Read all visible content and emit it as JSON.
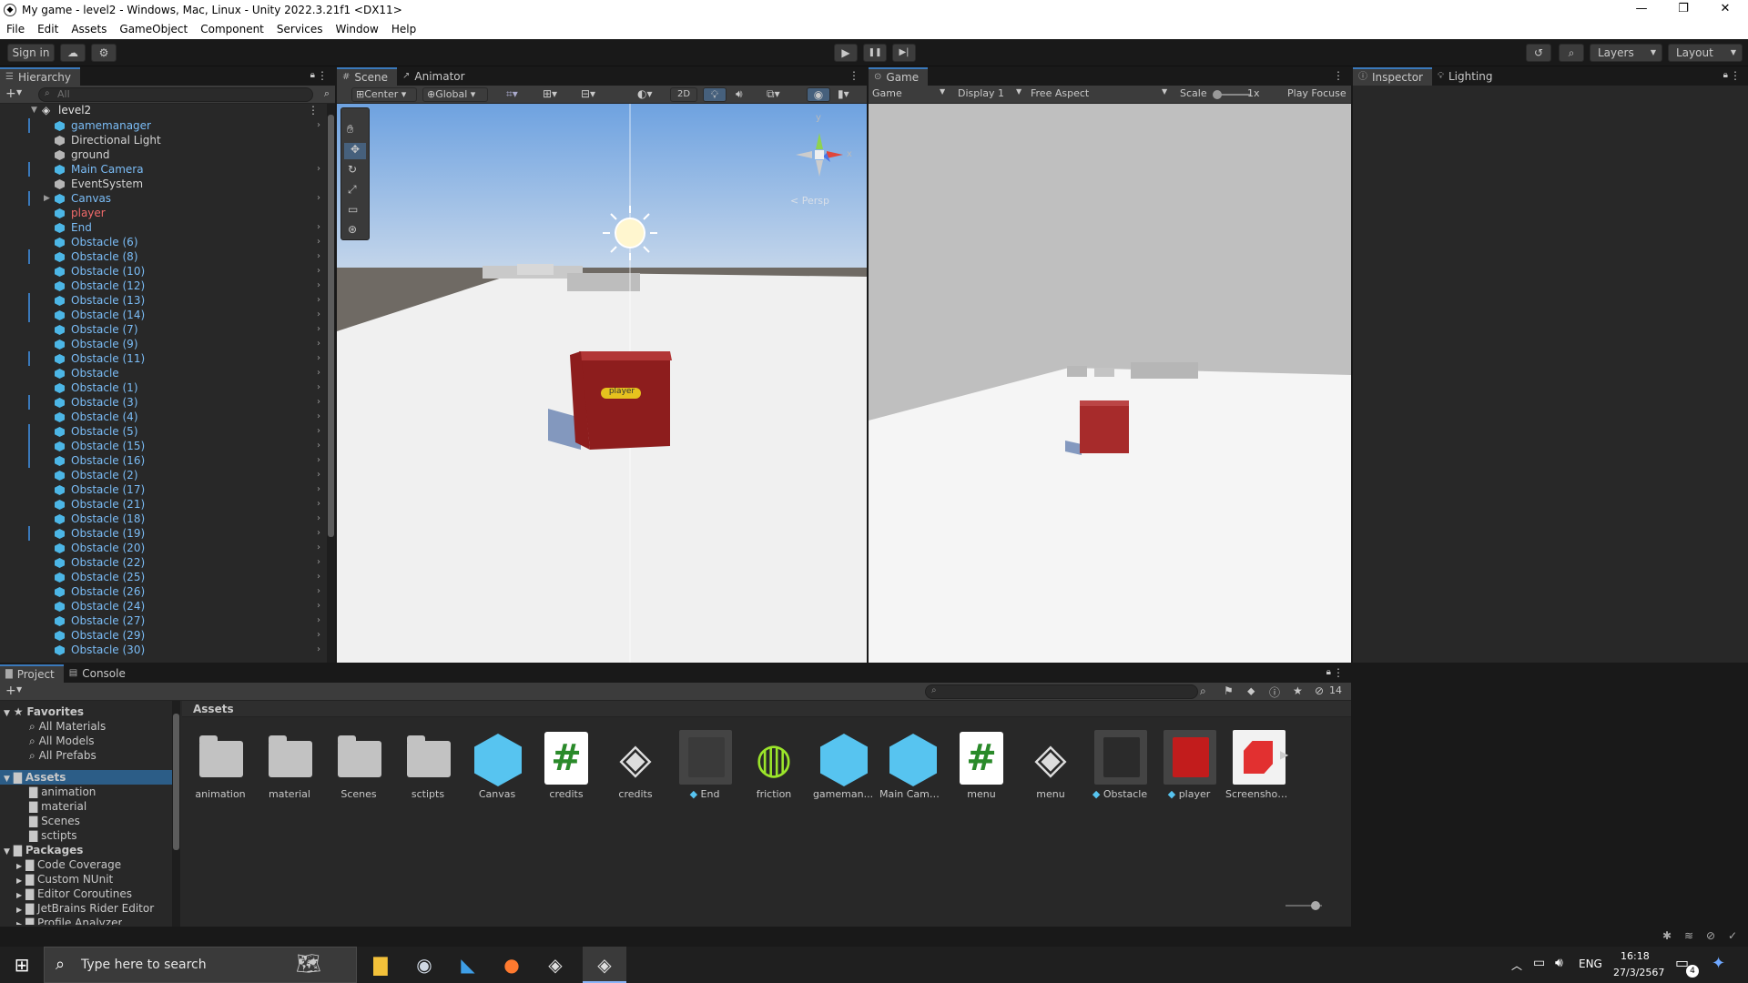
{
  "window": {
    "title": "My game - level2 - Windows, Mac, Linux - Unity 2022.3.21f1 <DX11>",
    "min": "—",
    "max": "❐",
    "close": "✕"
  },
  "menu": [
    "File",
    "Edit",
    "Assets",
    "GameObject",
    "Component",
    "Services",
    "Window",
    "Help"
  ],
  "toolbar": {
    "sign_in": "Sign in",
    "layers": "Layers",
    "layout": "Layout",
    "play": "▶",
    "pause": "❚❚",
    "step": "▶|"
  },
  "hierarchy": {
    "tab": "Hierarchy",
    "search_placeholder": "All",
    "scene": "level2",
    "items": [
      {
        "name": "gamemanager",
        "style": "blue",
        "chev": true,
        "mark": true
      },
      {
        "name": "Directional Light",
        "style": "white",
        "chev": false,
        "mark": false,
        "icon": "gray"
      },
      {
        "name": "ground",
        "style": "white",
        "chev": false,
        "mark": false,
        "icon": "gray"
      },
      {
        "name": "Main Camera",
        "style": "blue",
        "chev": true,
        "mark": true
      },
      {
        "name": "EventSystem",
        "style": "white",
        "chev": false,
        "mark": false,
        "icon": "gray"
      },
      {
        "name": "Canvas",
        "style": "blue",
        "chev": true,
        "mark": true,
        "tri": true
      },
      {
        "name": "player",
        "style": "red",
        "chev": false,
        "mark": false
      },
      {
        "name": "End",
        "style": "blue",
        "chev": true,
        "mark": false
      },
      {
        "name": "Obstacle (6)",
        "style": "blue",
        "chev": true,
        "mark": false
      },
      {
        "name": "Obstacle (8)",
        "style": "blue",
        "chev": true,
        "mark": true
      },
      {
        "name": "Obstacle (10)",
        "style": "blue",
        "chev": true,
        "mark": false
      },
      {
        "name": "Obstacle (12)",
        "style": "blue",
        "chev": true,
        "mark": false
      },
      {
        "name": "Obstacle (13)",
        "style": "blue",
        "chev": true,
        "mark": true
      },
      {
        "name": "Obstacle (14)",
        "style": "blue",
        "chev": true,
        "mark": true
      },
      {
        "name": "Obstacle (7)",
        "style": "blue",
        "chev": true,
        "mark": false
      },
      {
        "name": "Obstacle (9)",
        "style": "blue",
        "chev": true,
        "mark": false
      },
      {
        "name": "Obstacle (11)",
        "style": "blue",
        "chev": true,
        "mark": true
      },
      {
        "name": "Obstacle",
        "style": "blue",
        "chev": true,
        "mark": false
      },
      {
        "name": "Obstacle (1)",
        "style": "blue",
        "chev": true,
        "mark": false
      },
      {
        "name": "Obstacle (3)",
        "style": "blue",
        "chev": true,
        "mark": true
      },
      {
        "name": "Obstacle (4)",
        "style": "blue",
        "chev": true,
        "mark": false
      },
      {
        "name": "Obstacle (5)",
        "style": "blue",
        "chev": true,
        "mark": true
      },
      {
        "name": "Obstacle (15)",
        "style": "blue",
        "chev": true,
        "mark": true
      },
      {
        "name": "Obstacle (16)",
        "style": "blue",
        "chev": true,
        "mark": true
      },
      {
        "name": "Obstacle (2)",
        "style": "blue",
        "chev": true,
        "mark": false
      },
      {
        "name": "Obstacle (17)",
        "style": "blue",
        "chev": true,
        "mark": false
      },
      {
        "name": "Obstacle (21)",
        "style": "blue",
        "chev": true,
        "mark": false
      },
      {
        "name": "Obstacle (18)",
        "style": "blue",
        "chev": true,
        "mark": false
      },
      {
        "name": "Obstacle (19)",
        "style": "blue",
        "chev": true,
        "mark": true
      },
      {
        "name": "Obstacle (20)",
        "style": "blue",
        "chev": true,
        "mark": false
      },
      {
        "name": "Obstacle (22)",
        "style": "blue",
        "chev": true,
        "mark": false
      },
      {
        "name": "Obstacle (25)",
        "style": "blue",
        "chev": true,
        "mark": false
      },
      {
        "name": "Obstacle (26)",
        "style": "blue",
        "chev": true,
        "mark": false
      },
      {
        "name": "Obstacle (24)",
        "style": "blue",
        "chev": true,
        "mark": false
      },
      {
        "name": "Obstacle (27)",
        "style": "blue",
        "chev": true,
        "mark": false
      },
      {
        "name": "Obstacle (29)",
        "style": "blue",
        "chev": true,
        "mark": false
      },
      {
        "name": "Obstacle (30)",
        "style": "blue",
        "chev": true,
        "mark": false
      }
    ]
  },
  "scene": {
    "tab": "Scene",
    "tab2": "Animator",
    "center": "Center",
    "global": "Global",
    "btn_2d": "2D",
    "persp": "< Persp",
    "player_label": "player",
    "axis_y": "y",
    "axis_x": "x"
  },
  "game": {
    "tab": "Game",
    "mode": "Game",
    "display": "Display 1",
    "aspect": "Free Aspect",
    "scale_label": "Scale",
    "scale_val": "1x",
    "play_focus": "Play Focuse"
  },
  "inspector": {
    "tab": "Inspector",
    "tab2": "Lighting"
  },
  "project": {
    "tab": "Project",
    "tab2": "Console",
    "breadcrumb": "Assets",
    "hidden_count": "14",
    "favorites": {
      "label": "Favorites",
      "items": [
        "All Materials",
        "All Models",
        "All Prefabs"
      ]
    },
    "assets_root": {
      "label": "Assets",
      "items": [
        "animation",
        "material",
        "Scenes",
        "sctipts"
      ]
    },
    "packages": {
      "label": "Packages",
      "items": [
        "Code Coverage",
        "Custom NUnit",
        "Editor Coroutines",
        "JetBrains Rider Editor",
        "Profile Analyzer"
      ]
    },
    "grid": [
      {
        "label": "animation",
        "kind": "folder"
      },
      {
        "label": "material",
        "kind": "folder"
      },
      {
        "label": "Scenes",
        "kind": "folder"
      },
      {
        "label": "sctipts",
        "kind": "folder"
      },
      {
        "label": "Canvas",
        "kind": "cube"
      },
      {
        "label": "credits",
        "kind": "script"
      },
      {
        "label": "credits",
        "kind": "unity"
      },
      {
        "label": "End",
        "kind": "thumb",
        "color": "#3a3a3a",
        "prefab": true
      },
      {
        "label": "friction",
        "kind": "physic"
      },
      {
        "label": "gameman...",
        "kind": "cube"
      },
      {
        "label": "Main Came...",
        "kind": "cube"
      },
      {
        "label": "menu",
        "kind": "script"
      },
      {
        "label": "menu",
        "kind": "unity"
      },
      {
        "label": "Obstacle",
        "kind": "thumb",
        "color": "#2b2b2b",
        "prefab": true
      },
      {
        "label": "player",
        "kind": "thumb",
        "color": "#c21c1c",
        "prefab": true
      },
      {
        "label": "Screenshot...",
        "kind": "shot"
      }
    ]
  },
  "taskbar": {
    "search": "Type here to search",
    "lang": "ENG",
    "time": "16:18",
    "date": "27/3/2567",
    "notif_count": "4"
  },
  "colors": {
    "accent": "#3a79bb",
    "hier_blue": "#7bbdf7",
    "player_red": "#f26a6a",
    "cube_red": "#9b2222"
  }
}
